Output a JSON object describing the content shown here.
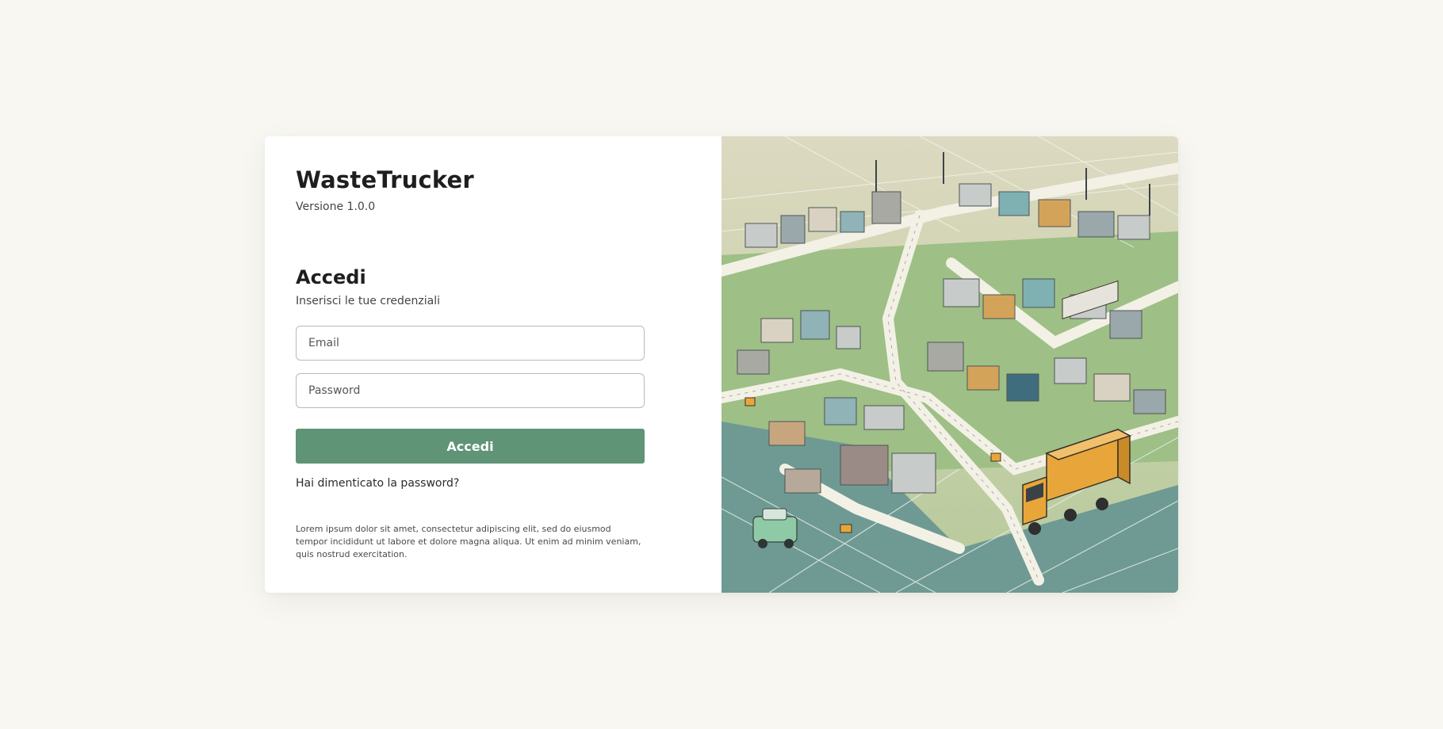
{
  "app": {
    "title": "WasteTrucker",
    "version": "Versione 1.0.0"
  },
  "login": {
    "title": "Accedi",
    "subtitle": "Inserisci le tue credenziali",
    "email_placeholder": "Email",
    "password_placeholder": "Password",
    "submit_label": "Accedi",
    "forgot_label": "Hai dimenticato la password?",
    "legal_text": "Lorem ipsum dolor sit amet, consectetur adipiscing elit, sed do eiusmod tempor incididunt ut labore et dolore magna aliqua. Ut enim ad minim veniam, quis nostrud exercitation."
  },
  "theme": {
    "accent": "#5f9476",
    "background": "#f8f7f2",
    "truck": "#e8a63a"
  },
  "illustration": {
    "subject": "city-with-waste-truck"
  }
}
